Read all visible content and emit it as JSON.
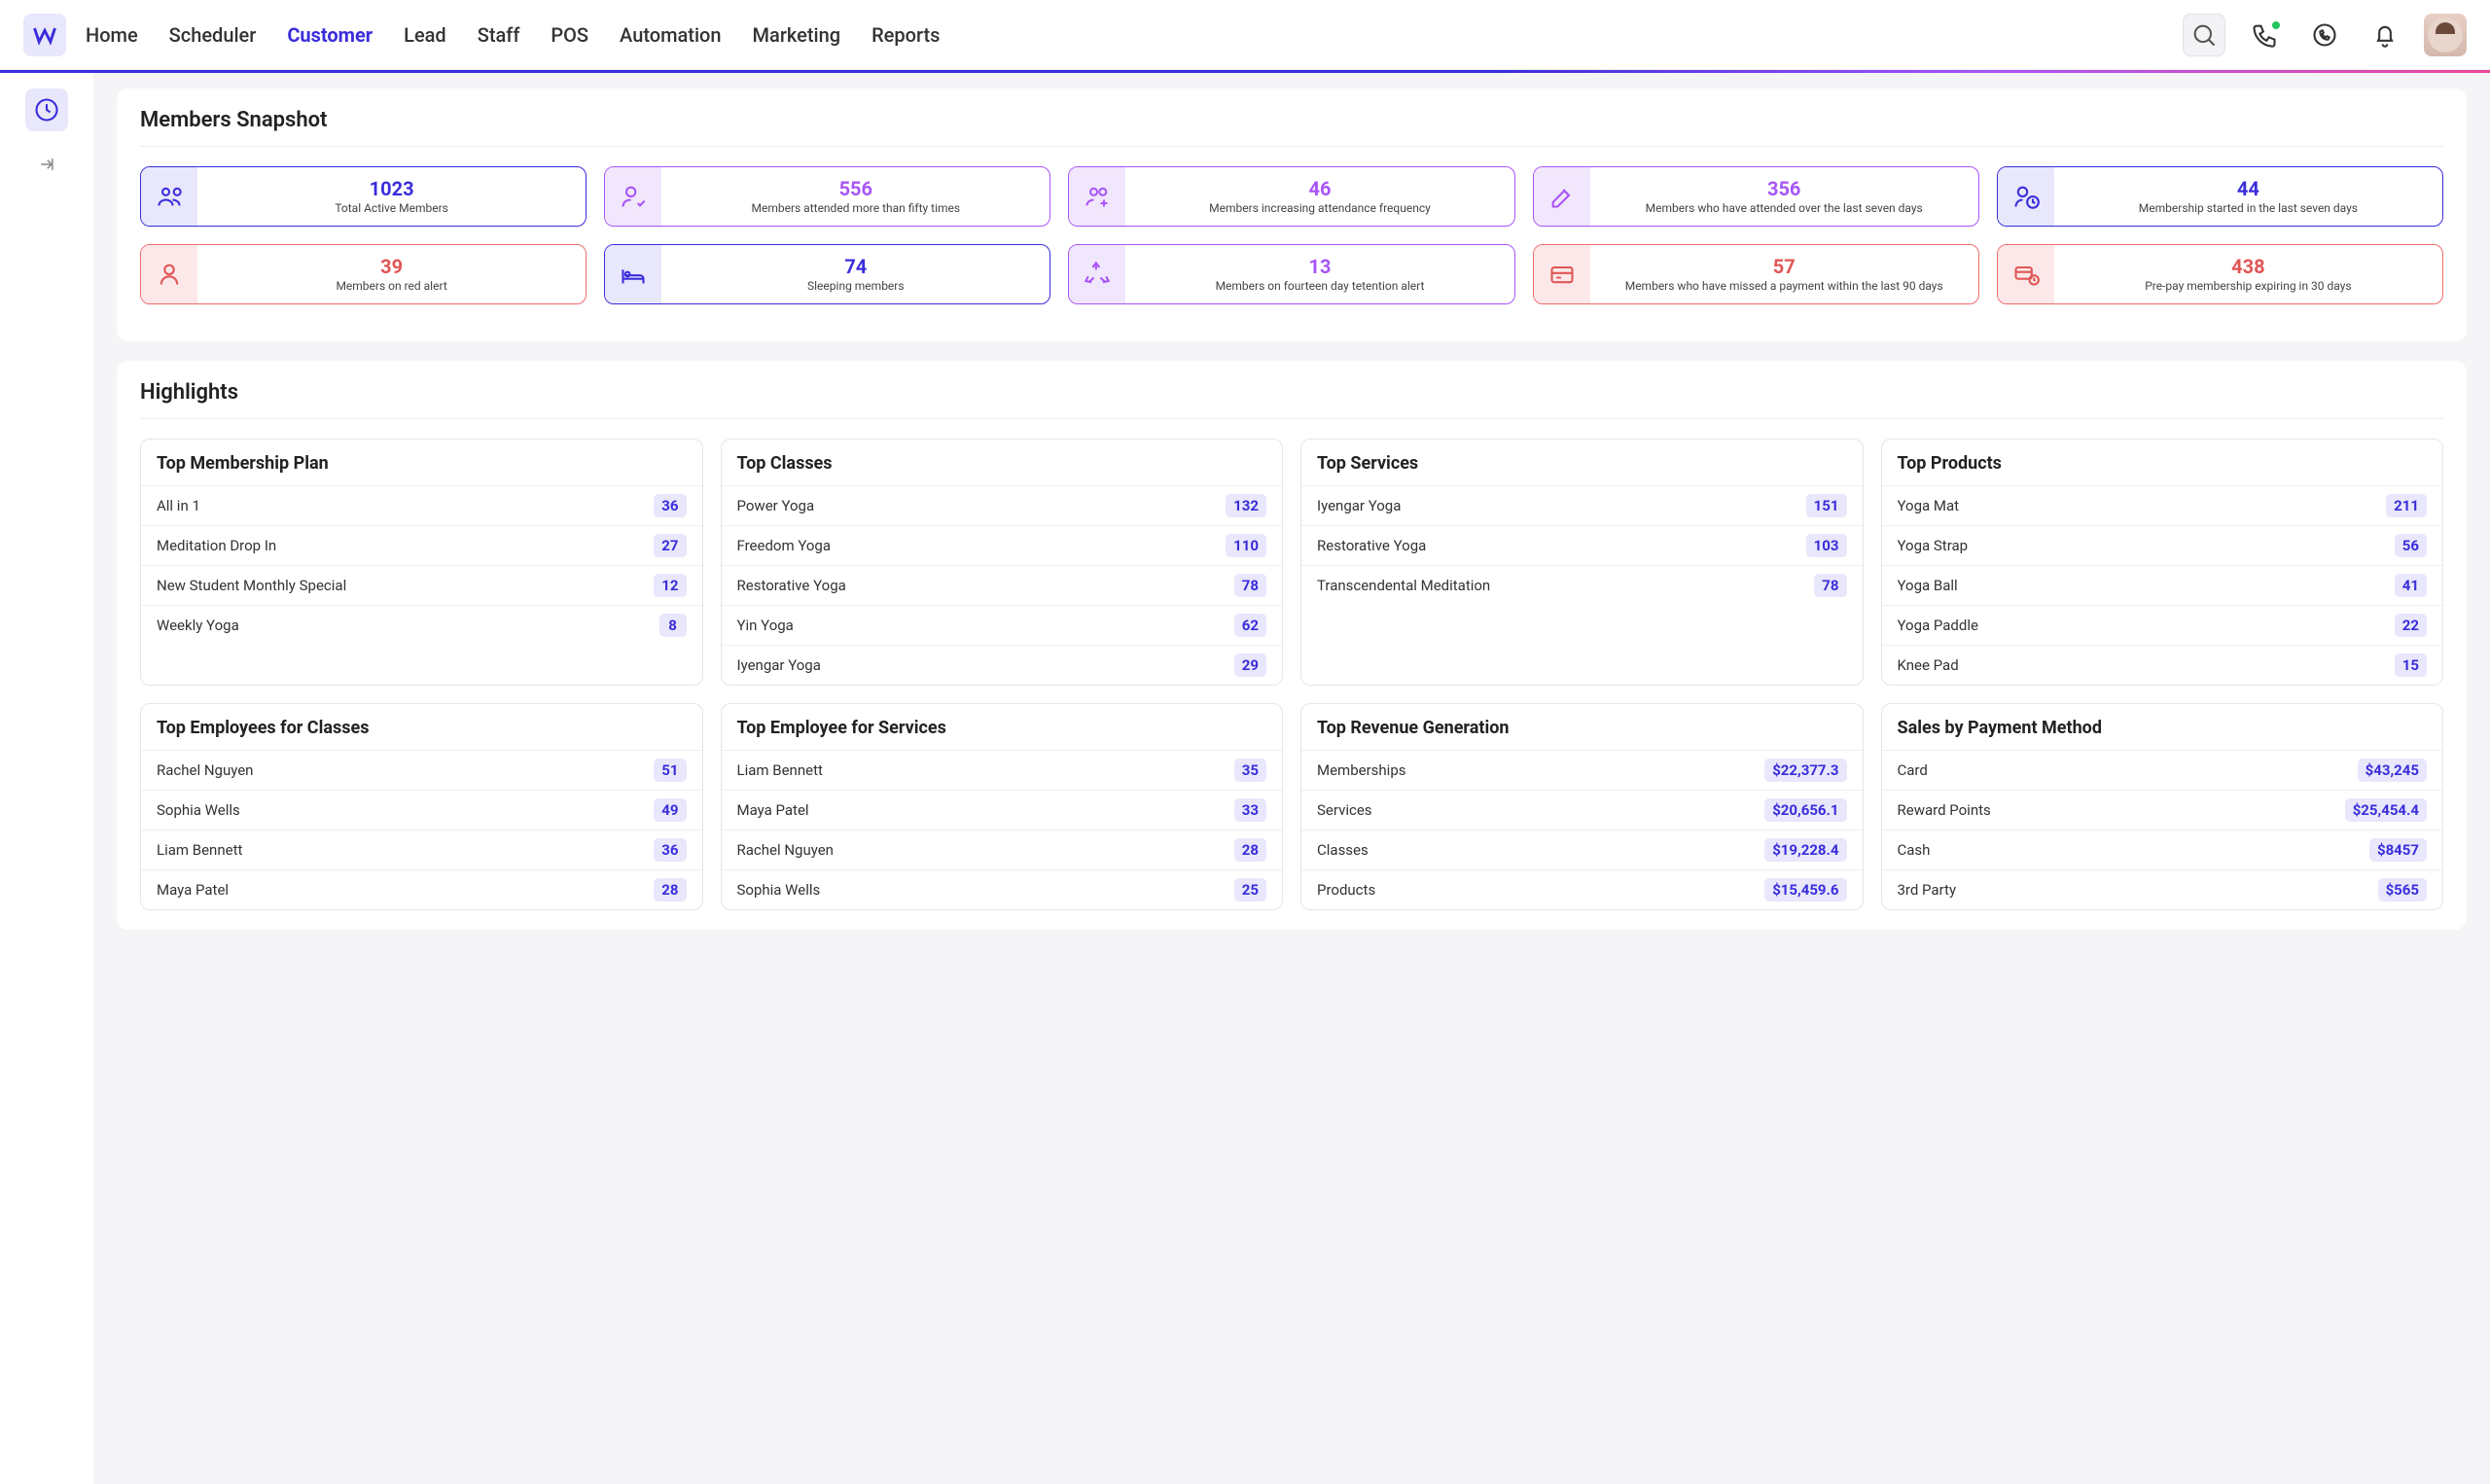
{
  "nav": {
    "items": [
      "Home",
      "Scheduler",
      "Customer",
      "Lead",
      "Staff",
      "POS",
      "Automation",
      "Marketing",
      "Reports"
    ],
    "active": "Customer"
  },
  "sections": {
    "snapshot_title": "Members Snapshot",
    "highlights_title": "Highlights"
  },
  "snapshot": [
    {
      "value": "1023",
      "label": "Total Active Members",
      "color": "blue",
      "icon": "users"
    },
    {
      "value": "556",
      "label": "Members attended more than fifty times",
      "color": "purple",
      "icon": "user-check"
    },
    {
      "value": "46",
      "label": "Members increasing attendance frequency",
      "color": "purple",
      "icon": "users-plus"
    },
    {
      "value": "356",
      "label": "Members who have attended over the last seven days",
      "color": "purple",
      "icon": "edit"
    },
    {
      "value": "44",
      "label": "Membership started in the last seven days",
      "color": "blue",
      "icon": "user-clock"
    },
    {
      "value": "39",
      "label": "Members on red alert",
      "color": "red",
      "icon": "user-single"
    },
    {
      "value": "74",
      "label": "Sleeping members",
      "color": "blue",
      "icon": "bed"
    },
    {
      "value": "13",
      "label": "Members on fourteen day tetention alert",
      "color": "purple",
      "icon": "recycle"
    },
    {
      "value": "57",
      "label": "Members who have missed a payment within the last 90 days",
      "color": "red",
      "icon": "credit-card"
    },
    {
      "value": "438",
      "label": "Pre-pay membership expiring in 30 days",
      "color": "red",
      "icon": "card-clock"
    }
  ],
  "highlights": [
    {
      "title": "Top Membership Plan",
      "rows": [
        {
          "name": "All in 1",
          "value": "36"
        },
        {
          "name": "Meditation Drop In",
          "value": "27"
        },
        {
          "name": "New Student Monthly Special",
          "value": "12"
        },
        {
          "name": "Weekly Yoga",
          "value": "8"
        }
      ]
    },
    {
      "title": "Top Classes",
      "rows": [
        {
          "name": "Power Yoga",
          "value": "132"
        },
        {
          "name": "Freedom Yoga",
          "value": "110"
        },
        {
          "name": "Restorative Yoga",
          "value": "78"
        },
        {
          "name": "Yin Yoga",
          "value": "62"
        },
        {
          "name": "Iyengar Yoga",
          "value": "29"
        }
      ]
    },
    {
      "title": "Top Services",
      "rows": [
        {
          "name": "Iyengar Yoga",
          "value": "151"
        },
        {
          "name": "Restorative Yoga",
          "value": "103"
        },
        {
          "name": "Transcendental Meditation",
          "value": "78"
        }
      ]
    },
    {
      "title": "Top Products",
      "rows": [
        {
          "name": "Yoga Mat",
          "value": "211"
        },
        {
          "name": "Yoga Strap",
          "value": "56"
        },
        {
          "name": "Yoga Ball",
          "value": "41"
        },
        {
          "name": "Yoga Paddle",
          "value": "22"
        },
        {
          "name": "Knee Pad",
          "value": "15"
        }
      ]
    },
    {
      "title": "Top Employees for Classes",
      "rows": [
        {
          "name": "Rachel Nguyen",
          "value": "51"
        },
        {
          "name": "Sophia Wells",
          "value": "49"
        },
        {
          "name": "Liam Bennett",
          "value": "36"
        },
        {
          "name": "Maya Patel",
          "value": "28"
        }
      ]
    },
    {
      "title": "Top Employee for Services",
      "rows": [
        {
          "name": "Liam Bennett",
          "value": "35"
        },
        {
          "name": "Maya Patel",
          "value": "33"
        },
        {
          "name": "Rachel Nguyen",
          "value": "28"
        },
        {
          "name": "Sophia Wells",
          "value": "25"
        }
      ]
    },
    {
      "title": "Top Revenue Generation",
      "rows": [
        {
          "name": "Memberships",
          "value": "$22,377.3"
        },
        {
          "name": "Services",
          "value": "$20,656.1"
        },
        {
          "name": "Classes",
          "value": "$19,228.4"
        },
        {
          "name": "Products",
          "value": "$15,459.6"
        }
      ]
    },
    {
      "title": "Sales by Payment Method",
      "rows": [
        {
          "name": "Card",
          "value": "$43,245"
        },
        {
          "name": "Reward Points",
          "value": "$25,454.4"
        },
        {
          "name": "Cash",
          "value": "$8457"
        },
        {
          "name": "3rd Party",
          "value": "$565"
        }
      ]
    }
  ]
}
